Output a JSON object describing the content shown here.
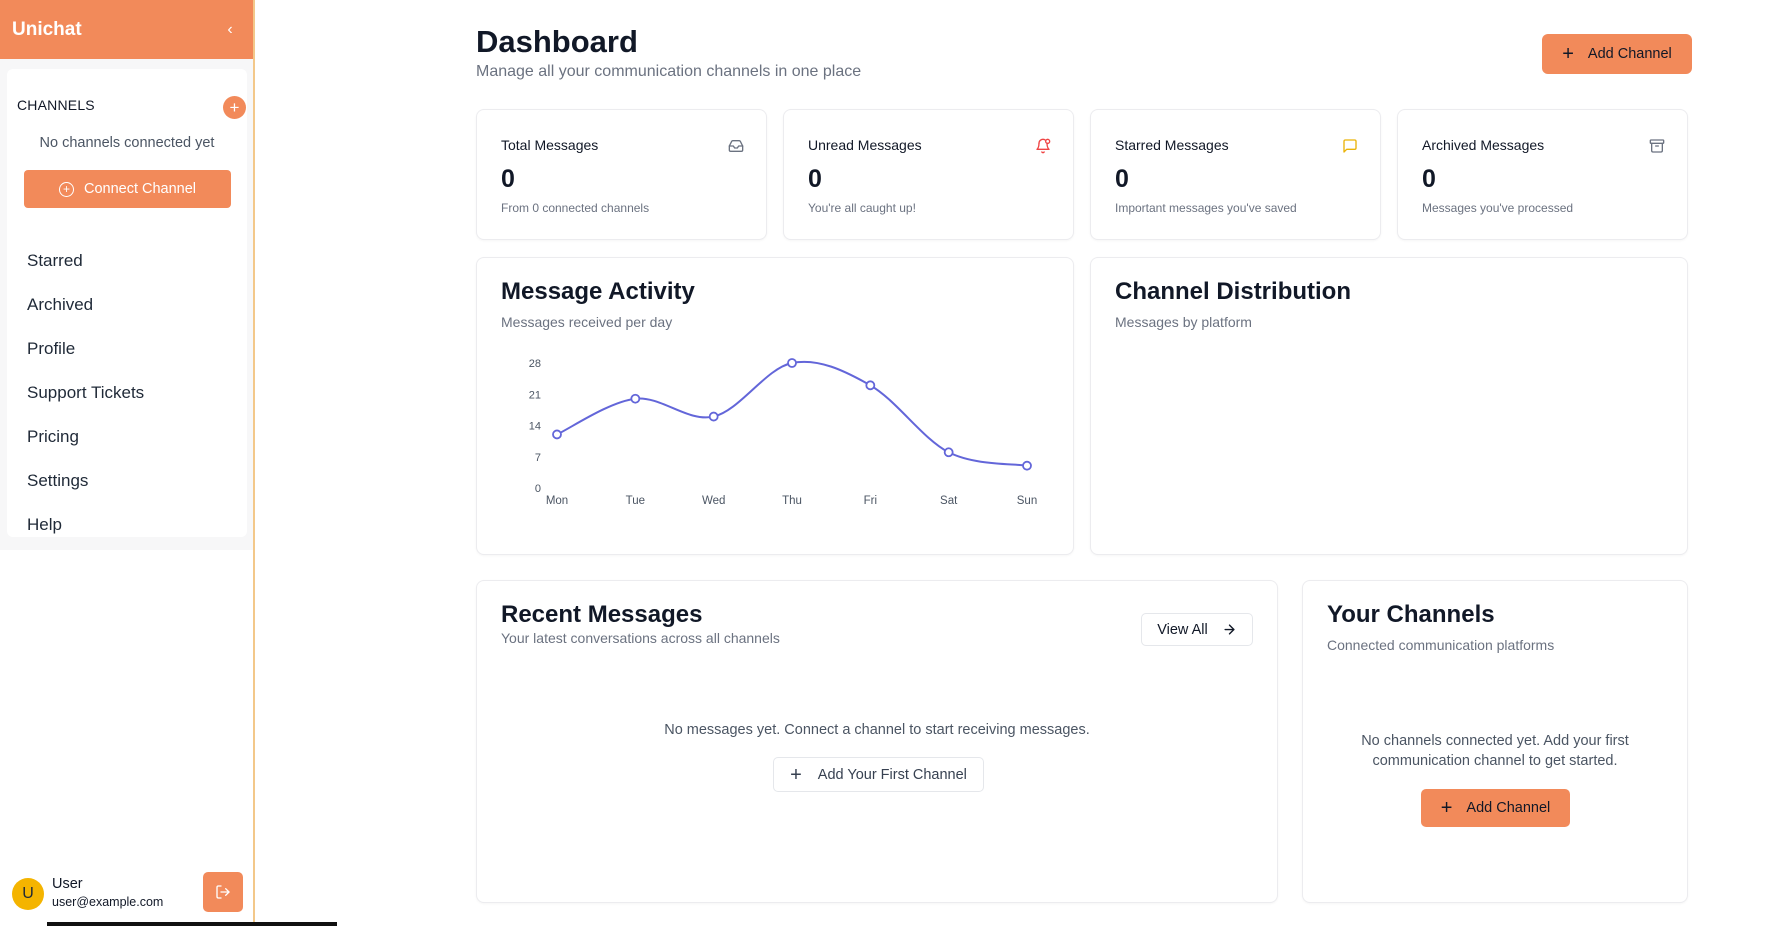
{
  "sidebar": {
    "brand": "Unichat",
    "collapse_glyph": "‹",
    "channels_heading": "CHANNELS",
    "channels_empty": "No channels connected yet",
    "connect_label": "Connect Channel",
    "nav": [
      {
        "label": "Starred"
      },
      {
        "label": "Archived"
      },
      {
        "label": "Profile"
      },
      {
        "label": "Support Tickets"
      },
      {
        "label": "Pricing"
      },
      {
        "label": "Settings"
      },
      {
        "label": "Help"
      }
    ],
    "user": {
      "initial": "U",
      "name": "User",
      "email": "user@example.com"
    }
  },
  "header": {
    "title": "Dashboard",
    "subtitle": "Manage all your communication channels in one place",
    "add_channel_label": "Add Channel"
  },
  "stats": [
    {
      "title": "Total Messages",
      "value": "0",
      "desc": "From 0 connected channels",
      "icon": "inbox-icon",
      "color": "#6b7280"
    },
    {
      "title": "Unread Messages",
      "value": "0",
      "desc": "You're all caught up!",
      "icon": "bell-icon",
      "color": "#ef4444"
    },
    {
      "title": "Starred Messages",
      "value": "0",
      "desc": "Important messages you've saved",
      "icon": "message-square-icon",
      "color": "#eab308"
    },
    {
      "title": "Archived Messages",
      "value": "0",
      "desc": "Messages you've processed",
      "icon": "archive-icon",
      "color": "#6b7280"
    }
  ],
  "activity": {
    "title": "Message Activity",
    "subtitle": "Messages received per day"
  },
  "distribution": {
    "title": "Channel Distribution",
    "subtitle": "Messages by platform"
  },
  "recent": {
    "title": "Recent Messages",
    "subtitle": "Your latest conversations across all channels",
    "view_all": "View All",
    "empty": "No messages yet. Connect a channel to start receiving messages.",
    "first_channel": "Add Your First Channel"
  },
  "your_channels": {
    "title": "Your Channels",
    "subtitle": "Connected communication platforms",
    "empty_line1": "No channels connected yet. Add your first",
    "empty_line2": "communication channel to get started.",
    "add_label": "Add Channel"
  },
  "colors": {
    "accent": "#f28a5a",
    "line": "#6366d9"
  },
  "chart_data": {
    "type": "line",
    "title": "",
    "categories": [
      "Mon",
      "Tue",
      "Wed",
      "Thu",
      "Fri",
      "Sat",
      "Sun"
    ],
    "series": [
      {
        "values": [
          12,
          20,
          16,
          28,
          23,
          8,
          5
        ]
      }
    ],
    "yticks": [
      0,
      7,
      14,
      21,
      28
    ],
    "ylim": [
      0,
      28
    ],
    "grid": false,
    "legend": "none"
  }
}
